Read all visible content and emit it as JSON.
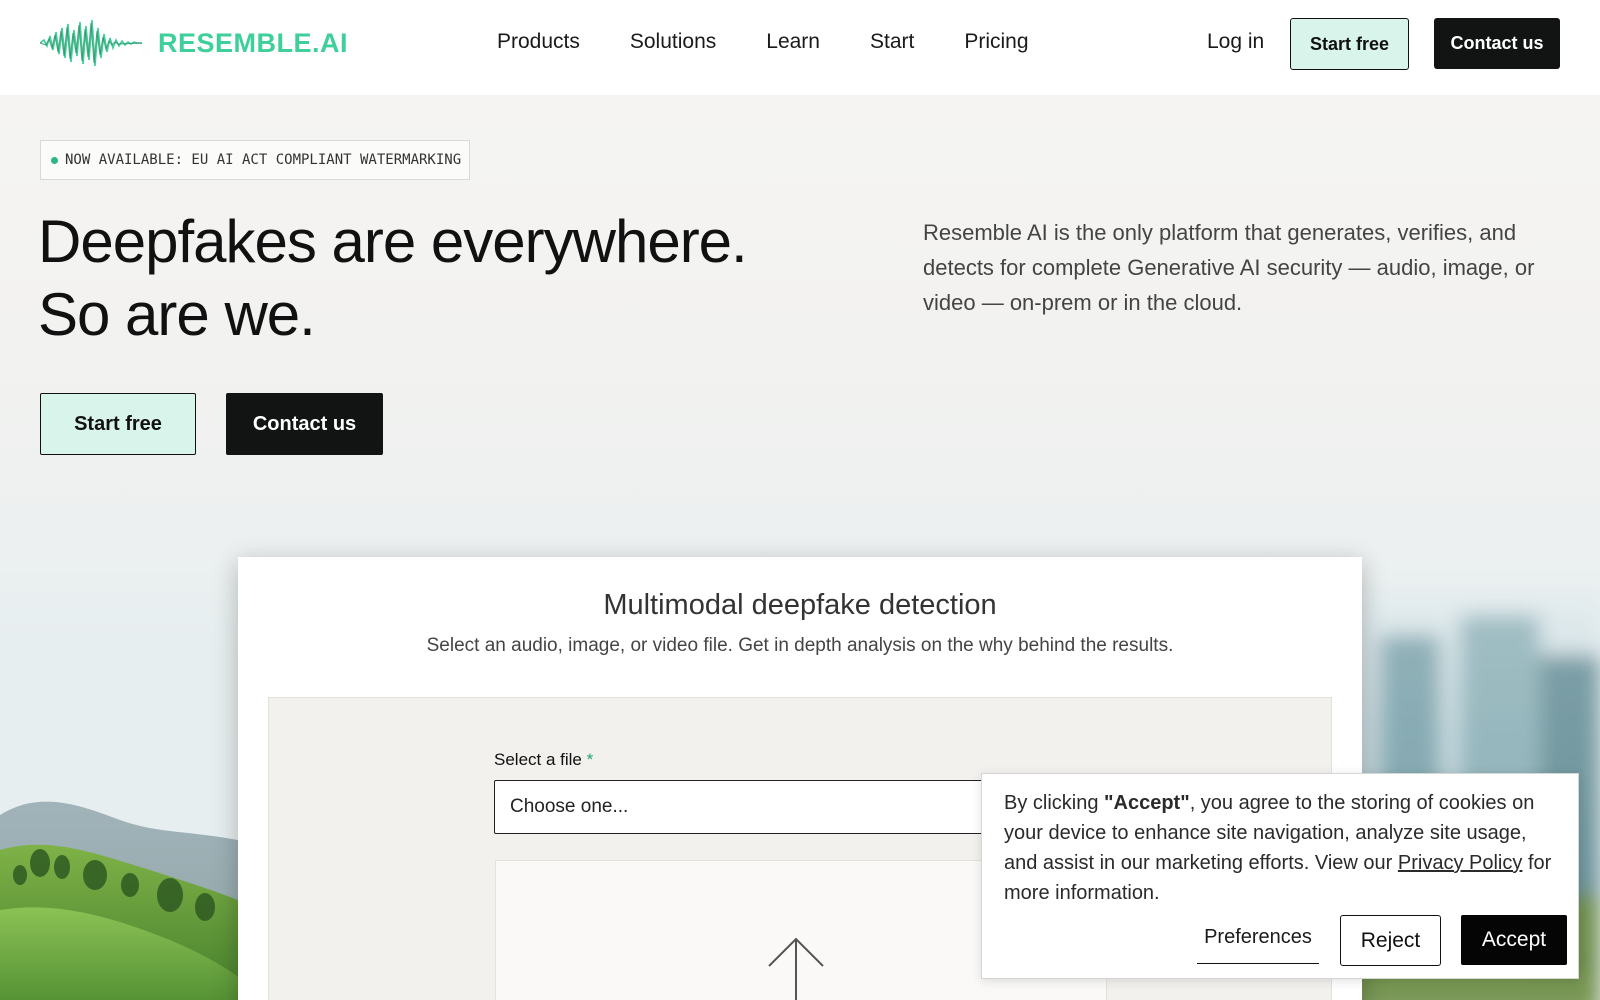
{
  "header": {
    "logo_text": "RESEMBLE.AI",
    "logo_icon": "waveform-icon",
    "nav": [
      "Products",
      "Solutions",
      "Learn",
      "Start",
      "Pricing"
    ],
    "login_label": "Log in",
    "start_free_label": "Start free",
    "contact_label": "Contact us"
  },
  "hero": {
    "badge": "NOW AVAILABLE: EU AI ACT COMPLIANT WATERMARKING",
    "headline_line1": "Deepfakes are everywhere.",
    "headline_line2": "So are we.",
    "description": "Resemble AI is the only platform that generates, verifies, and detects for complete Generative AI security — audio, image, or video — on-prem or in the cloud.",
    "start_free_label": "Start free",
    "contact_label": "Contact us"
  },
  "detection": {
    "title": "Multimodal deepfake detection",
    "subtitle": "Select an audio, image, or video file. Get in depth analysis on the why behind the results.",
    "file_label": "Select a file",
    "required_marker": "*",
    "select_value": "Choose one...",
    "upload_icon": "upload-arrow-icon"
  },
  "cookie": {
    "text_before": "By clicking ",
    "text_bold": "\"Accept\"",
    "text_middle": ", you agree to the storing of cookies on your device to enhance site navigation, analyze site usage, and assist in our marketing efforts. View our ",
    "link_text": "Privacy Policy",
    "text_after": " for more information.",
    "preferences_label": "Preferences",
    "reject_label": "Reject",
    "accept_label": "Accept"
  },
  "colors": {
    "brand_green": "#3fcf9a",
    "button_mint": "#d9f4ea",
    "button_dark": "#111413"
  }
}
